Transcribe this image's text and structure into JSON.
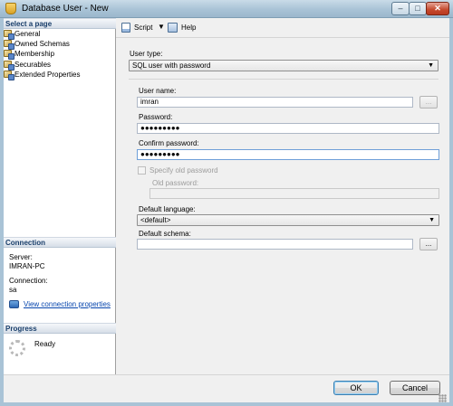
{
  "window": {
    "title": "Database User - New",
    "minimize_glyph": "–",
    "maximize_glyph": "□",
    "close_glyph": "✕",
    "title_icon": "database-icon"
  },
  "left_pane": {
    "select_page_header": "Select a page",
    "pages": [
      {
        "label": "General",
        "icon": "page-icon"
      },
      {
        "label": "Owned Schemas",
        "icon": "page-icon"
      },
      {
        "label": "Membership",
        "icon": "page-icon"
      },
      {
        "label": "Securables",
        "icon": "page-icon"
      },
      {
        "label": "Extended Properties",
        "icon": "page-icon"
      }
    ],
    "connection": {
      "header": "Connection",
      "server_label": "Server:",
      "server_value": "IMRAN-PC",
      "connection_label": "Connection:",
      "connection_value": "sa",
      "view_link": "View connection properties"
    },
    "progress": {
      "header": "Progress",
      "status": "Ready"
    }
  },
  "toolbar": {
    "script_label": "Script",
    "script_dropdown_glyph": "▼",
    "help_label": "Help"
  },
  "form": {
    "user_type_label": "User type:",
    "user_type_value": "SQL user with password",
    "user_name_label": "User name:",
    "user_name_value": "imran",
    "password_label": "Password:",
    "password_value": "●●●●●●●●●",
    "confirm_password_label": "Confirm password:",
    "confirm_password_value": "●●●●●●●●●",
    "specify_old_password_label": "Specify old password",
    "old_password_label": "Old password:",
    "old_password_value": "",
    "default_language_label": "Default language:",
    "default_language_value": "<default>",
    "default_schema_label": "Default schema:",
    "default_schema_value": "",
    "ellipsis_label": "...",
    "dropdown_arrow": "▼"
  },
  "buttons": {
    "ok": "OK",
    "cancel": "Cancel"
  }
}
